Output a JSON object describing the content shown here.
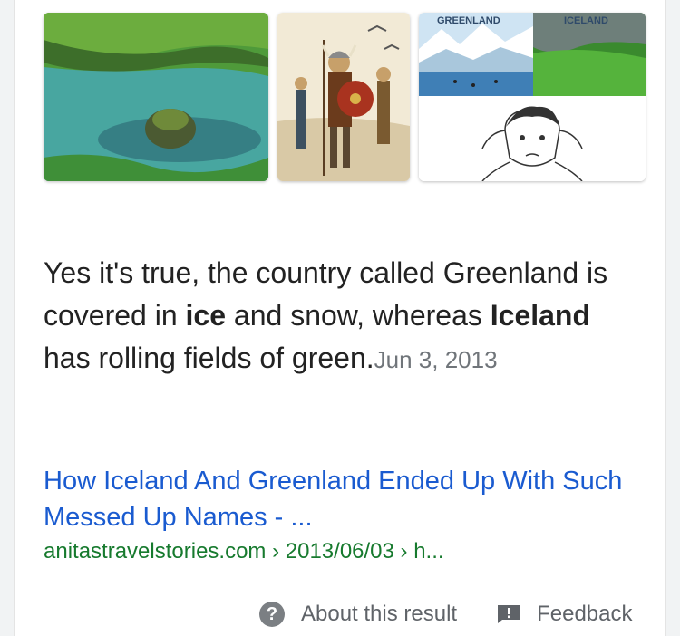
{
  "snippet": {
    "part1": "Yes it's true, the country called Greenland is covered in ",
    "bold1": "ice",
    "part2": " and snow, whereas ",
    "bold2": "Iceland",
    "part3": " has rolling fields of green.",
    "date": "Jun 3, 2013"
  },
  "result": {
    "title": "How Iceland And Greenland Ended Up With Such Messed Up Names - ...",
    "url": "anitastravelstories.com › 2013/06/03 › h..."
  },
  "images": {
    "collage_label_left": "GREENLAND",
    "collage_label_right": "ICELAND"
  },
  "footer": {
    "about_label": "About this result",
    "feedback_label": "Feedback"
  },
  "colors": {
    "link": "#1a5bd0",
    "url": "#177a2e",
    "text": "#222222",
    "muted": "#70757a"
  }
}
